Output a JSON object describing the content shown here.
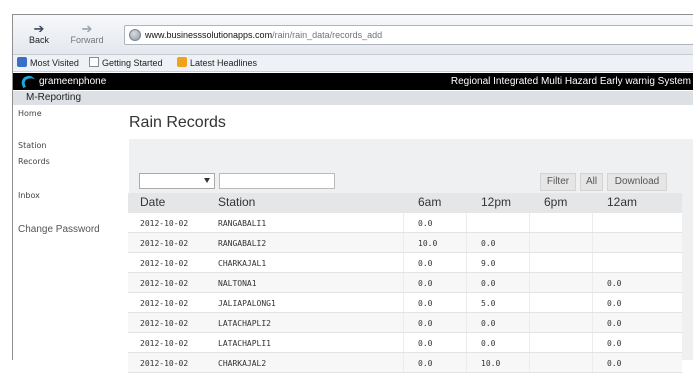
{
  "browser": {
    "back_label": "Back",
    "forward_label": "Forward",
    "url_domain": "www.businesssolutionapps.com",
    "url_path": "/rain/rain_data/records_add"
  },
  "bookmarks": [
    {
      "label": "Most Visited",
      "icon": "firefox-bookmark-icon"
    },
    {
      "label": "Getting Started",
      "icon": "page-icon"
    },
    {
      "label": "Latest Headlines",
      "icon": "rss-feed-icon"
    }
  ],
  "banner": {
    "logo_text": "grameenphone",
    "system_name": "Regional Integrated Multi Hazard Early warnig System"
  },
  "subheader": {
    "label": "M-Reporting"
  },
  "sidebar": {
    "home": "Home",
    "station": "Station",
    "records": "Records",
    "inbox": "Inbox",
    "change_password": "Change Password"
  },
  "page": {
    "title": "Rain Records"
  },
  "filters": {
    "select_value": "",
    "text_value": "",
    "filter_label": "Filter",
    "all_label": "All",
    "download_label": "Download"
  },
  "table": {
    "headers": [
      "Date",
      "Station",
      "6am",
      "12pm",
      "6pm",
      "12am"
    ],
    "rows": [
      [
        "2012-10-02",
        "RANGABALI1",
        "0.0",
        "",
        "",
        ""
      ],
      [
        "2012-10-02",
        "RANGABALI2",
        "10.0",
        "0.0",
        "",
        ""
      ],
      [
        "2012-10-02",
        "CHARKAJAL1",
        "0.0",
        "9.0",
        "",
        ""
      ],
      [
        "2012-10-02",
        "NALTONA1",
        "0.0",
        "0.0",
        "",
        "0.0"
      ],
      [
        "2012-10-02",
        "JALIAPALONG1",
        "0.0",
        "5.0",
        "",
        "0.0"
      ],
      [
        "2012-10-02",
        "LATACHAPLI2",
        "0.0",
        "0.0",
        "",
        "0.0"
      ],
      [
        "2012-10-02",
        "LATACHAPLI1",
        "0.0",
        "0.0",
        "",
        "0.0"
      ],
      [
        "2012-10-02",
        "CHARKAJAL2",
        "0.0",
        "10.0",
        "",
        "0.0"
      ]
    ]
  },
  "colors": {
    "banner_bg": "#000000",
    "logo_accent": "#1ca6e0",
    "panel_bg": "#eff0f1"
  }
}
